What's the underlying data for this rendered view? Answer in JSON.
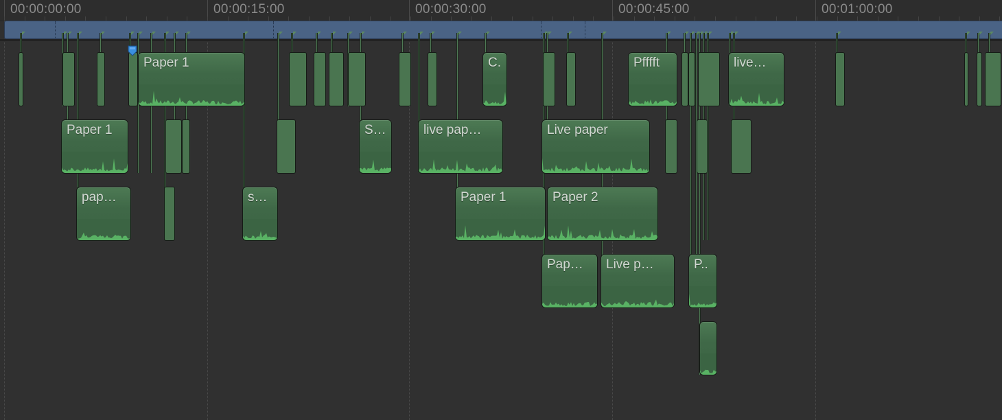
{
  "ruler": {
    "ticks": [
      "00:00:00:00",
      "00:00:15:00",
      "00:00:30:00",
      "00:00:45:00",
      "00:01:00:00"
    ]
  },
  "colors": {
    "background": "#303030",
    "storyline": "#4a6385",
    "clip": "#3f6847",
    "waveform": "#5fbf6a",
    "playhead": "#3a8fe0"
  },
  "clips": [
    {
      "name": "Paper 1"
    },
    {
      "name": "C."
    },
    {
      "name": "Pfffft"
    },
    {
      "name": "live…"
    },
    {
      "name": "Paper 1"
    },
    {
      "name": "S…"
    },
    {
      "name": "live pap…"
    },
    {
      "name": "Live paper"
    },
    {
      "name": "pap…"
    },
    {
      "name": "s…"
    },
    {
      "name": "Paper 1"
    },
    {
      "name": "Paper 2"
    },
    {
      "name": "Pap…"
    },
    {
      "name": "Live p…"
    },
    {
      "name": "P.."
    },
    {
      "name": ""
    }
  ],
  "playhead": {
    "icon": "playhead-marker-icon"
  }
}
